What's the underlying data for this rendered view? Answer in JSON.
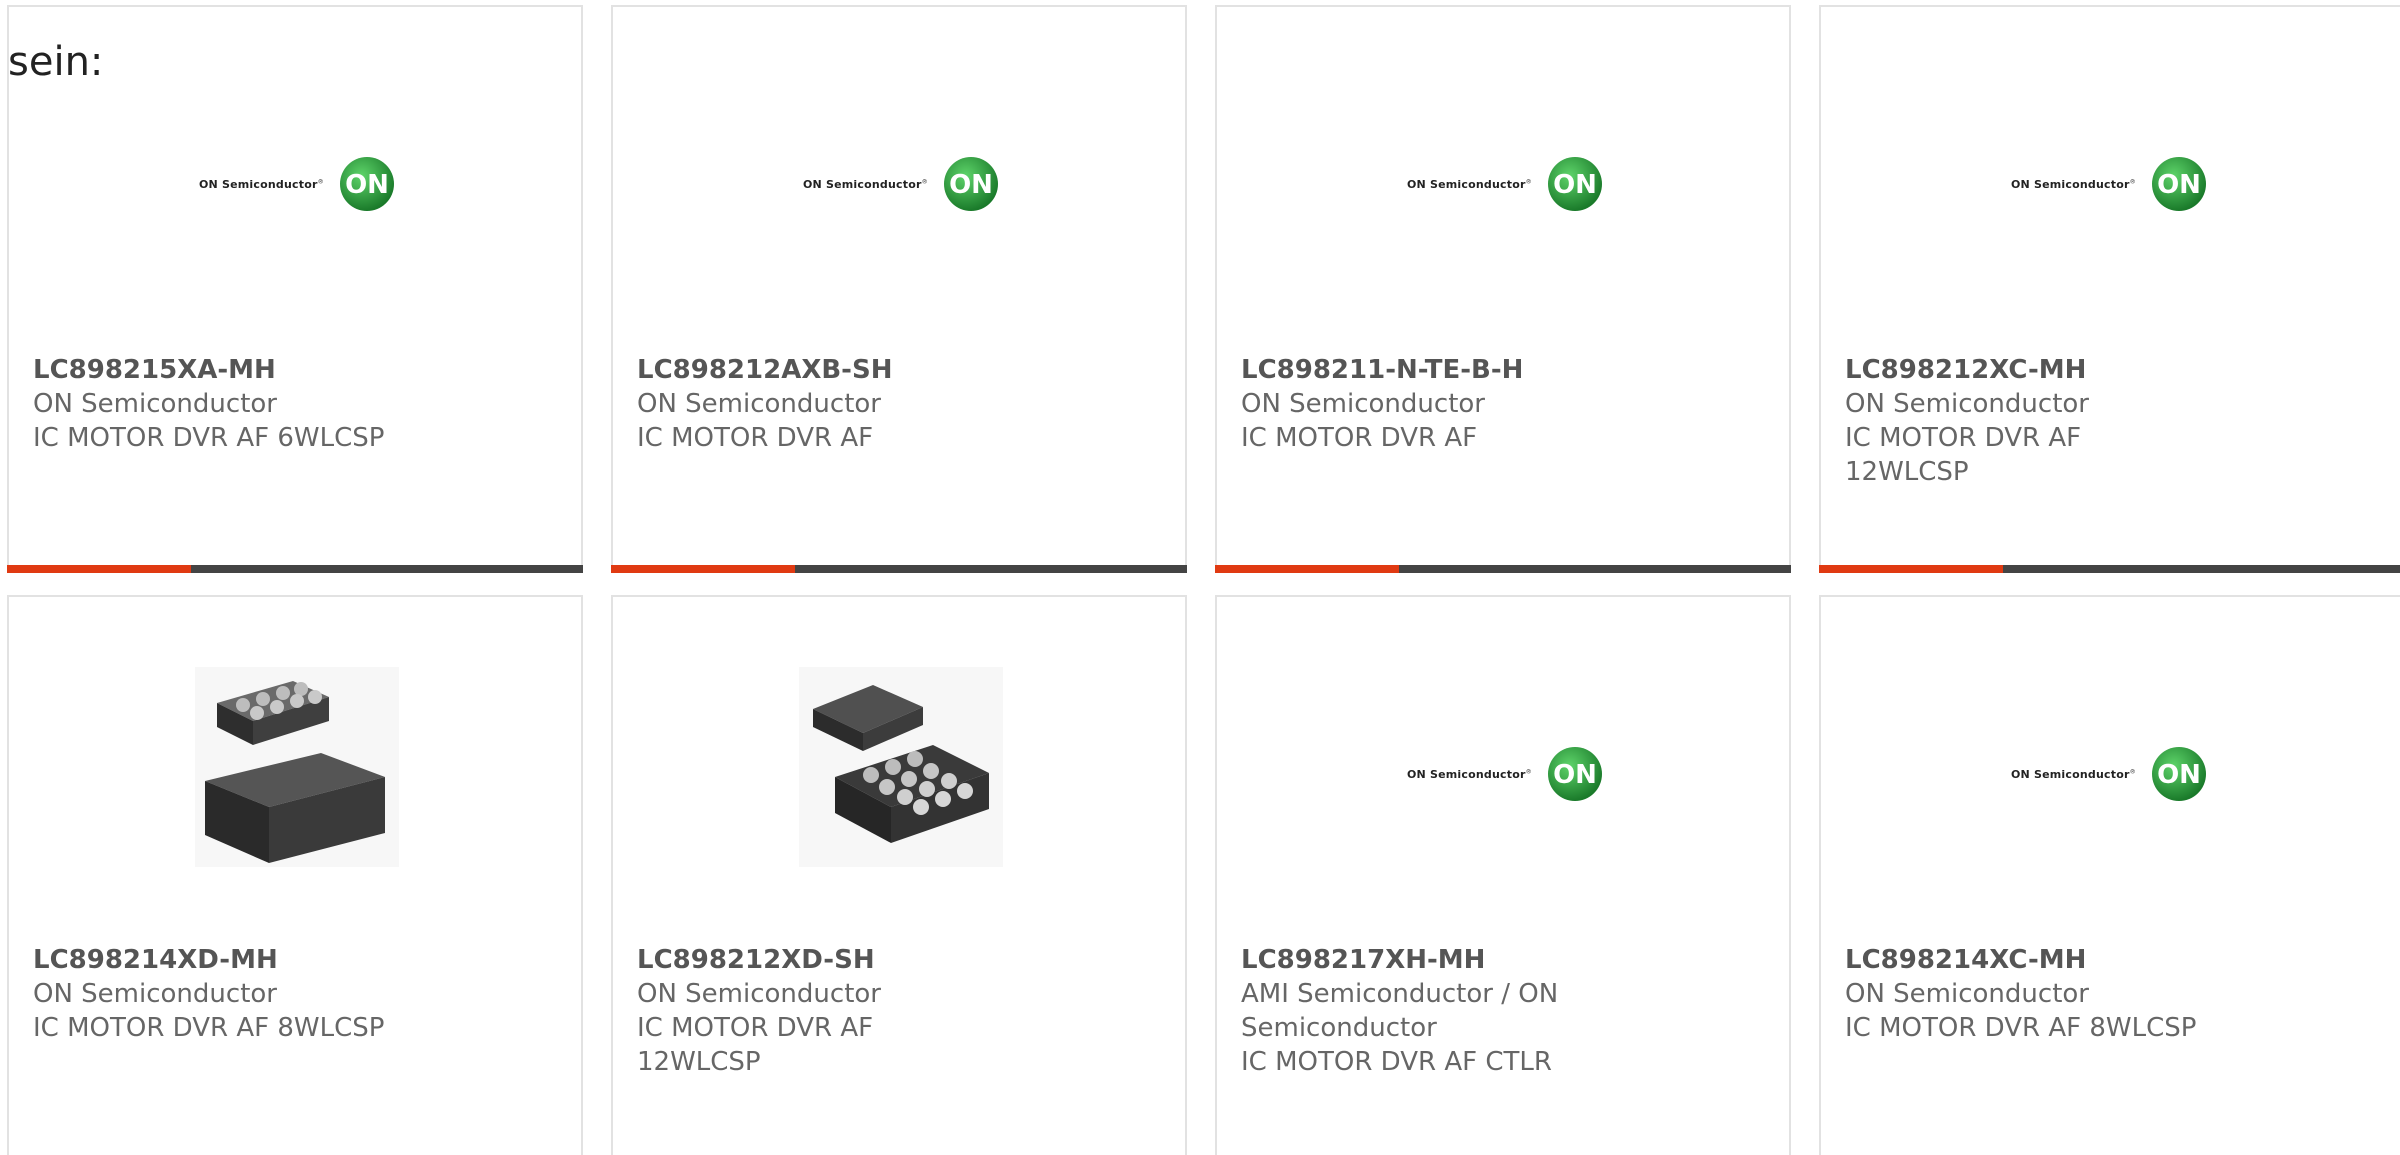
{
  "intro_text": "sein:",
  "colors": {
    "accent_bar": "#e03a12",
    "bar": "#444444",
    "logo_green": "#2a9a3c",
    "card_border": "#e2e2e2"
  },
  "logo": {
    "wordmark": "ON Semiconductor",
    "mark": "ON"
  },
  "products": [
    {
      "part": "LC898215XA-MH",
      "manufacturer": "ON Semiconductor",
      "description": "IC MOTOR DVR AF 6WLCSP",
      "image": "on-semiconductor-logo",
      "has_bar": true
    },
    {
      "part": "LC898212AXB-SH",
      "manufacturer": "ON Semiconductor",
      "description": "IC MOTOR DVR AF",
      "image": "on-semiconductor-logo",
      "has_bar": true
    },
    {
      "part": "LC898211-N-TE-B-H",
      "manufacturer": "ON Semiconductor",
      "description": "IC MOTOR DVR AF",
      "image": "on-semiconductor-logo",
      "has_bar": true
    },
    {
      "part": "LC898212XC-MH",
      "manufacturer": "ON Semiconductor",
      "description": "IC MOTOR DVR AF 12WLCSP",
      "image": "on-semiconductor-logo",
      "has_bar": true
    },
    {
      "part": "LC898214XD-MH",
      "manufacturer": "ON Semiconductor",
      "description": "IC MOTOR DVR AF 8WLCSP",
      "image": "wlcsp-chip-photo-8",
      "has_bar": false
    },
    {
      "part": "LC898212XD-SH",
      "manufacturer": "ON Semiconductor",
      "description": "IC MOTOR DVR AF 12WLCSP",
      "image": "wlcsp-chip-photo-12",
      "has_bar": false
    },
    {
      "part": "LC898217XH-MH",
      "manufacturer": "AMI Semiconductor / ON Semiconductor",
      "description": "IC MOTOR DVR AF CTLR",
      "image": "on-semiconductor-logo",
      "has_bar": false
    },
    {
      "part": "LC898214XC-MH",
      "manufacturer": "ON Semiconductor",
      "description": "IC MOTOR DVR AF 8WLCSP",
      "image": "on-semiconductor-logo",
      "has_bar": false
    }
  ]
}
